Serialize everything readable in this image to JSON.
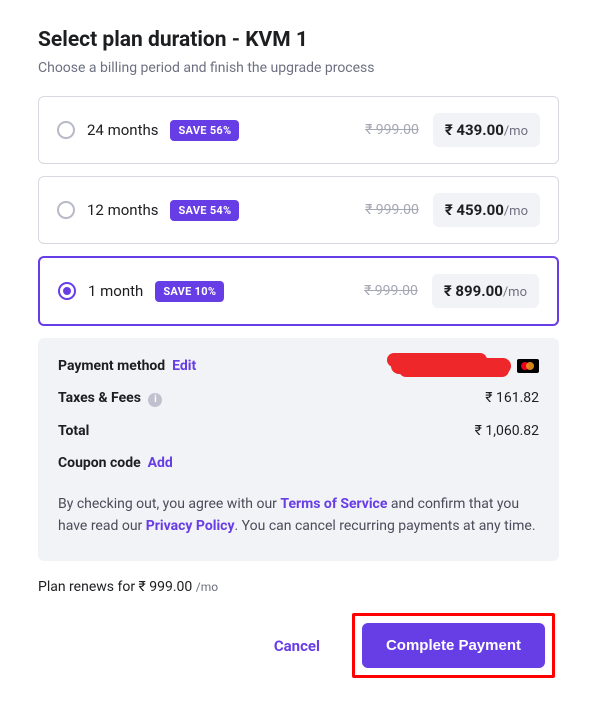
{
  "header": {
    "title": "Select plan duration - KVM 1",
    "subtitle": "Choose a billing period and finish the upgrade process"
  },
  "plans": [
    {
      "label": "24 months",
      "badge": "SAVE 56%",
      "strike": "₹ 999.00",
      "price": "₹ 439.00",
      "per": "/mo",
      "selected": false
    },
    {
      "label": "12 months",
      "badge": "SAVE 54%",
      "strike": "₹ 999.00",
      "price": "₹ 459.00",
      "per": "/mo",
      "selected": false
    },
    {
      "label": "1 month",
      "badge": "SAVE 10%",
      "strike": "₹ 999.00",
      "price": "₹ 899.00",
      "per": "/mo",
      "selected": true
    }
  ],
  "summary": {
    "payment_method_label": "Payment method",
    "edit_label": "Edit",
    "card_brand": "mastercard",
    "taxes_label": "Taxes & Fees",
    "taxes_value": "₹ 161.82",
    "total_label": "Total",
    "total_value": "₹ 1,060.82",
    "coupon_label": "Coupon code",
    "add_label": "Add"
  },
  "terms": {
    "pre": "By checking out, you agree with our ",
    "tos": "Terms of Service",
    "mid": " and confirm that you have read our ",
    "pp": "Privacy Policy",
    "post": ". You can cancel recurring payments at any time."
  },
  "renew": {
    "prefix": "Plan renews for ",
    "price": "₹ 999.00",
    "per": "/mo"
  },
  "actions": {
    "cancel": "Cancel",
    "complete": "Complete Payment"
  }
}
